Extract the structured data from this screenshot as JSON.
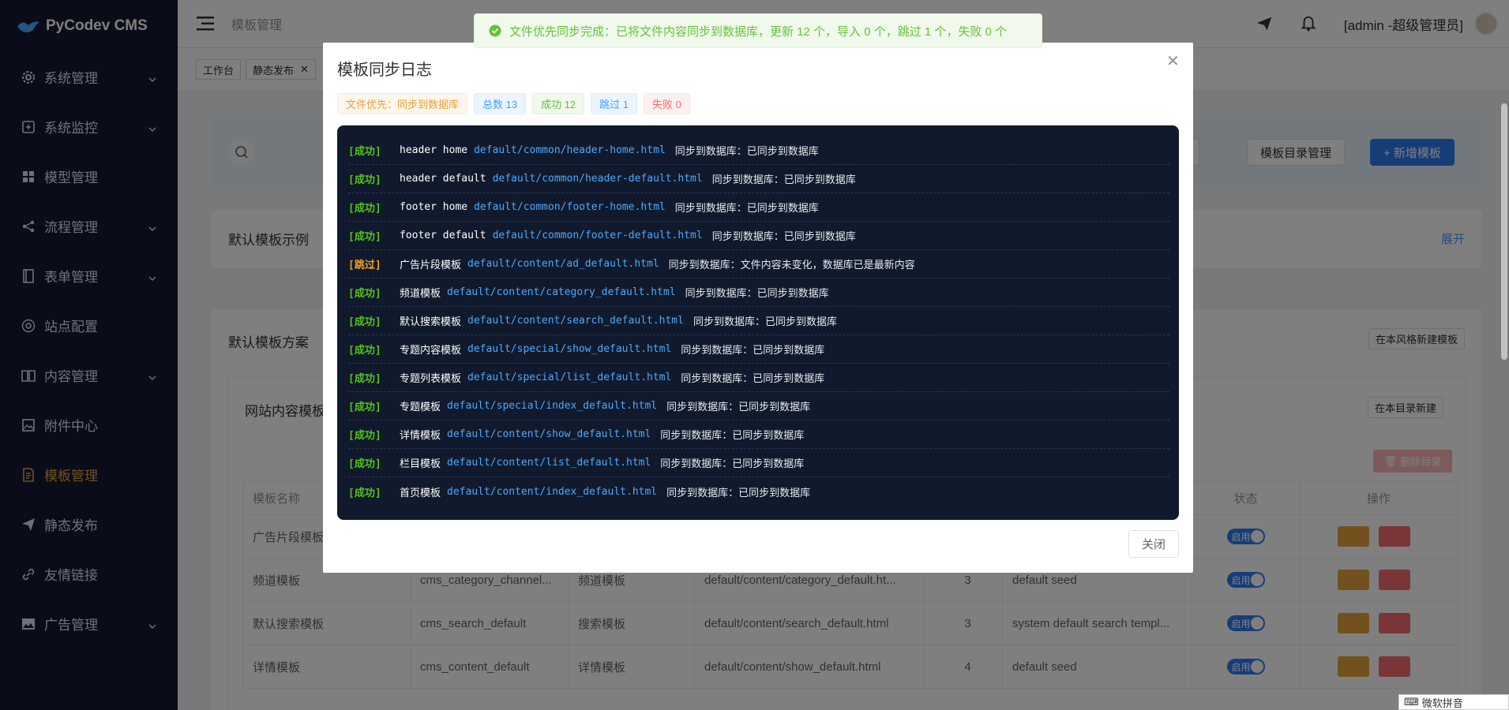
{
  "app": {
    "name": "PyCodev CMS"
  },
  "sidebar": {
    "items": [
      {
        "label": "系统管理",
        "icon": "gear-icon",
        "has_children": true
      },
      {
        "label": "系统监控",
        "icon": "monitor-icon",
        "has_children": true
      },
      {
        "label": "模型管理",
        "icon": "grid-icon",
        "has_children": false
      },
      {
        "label": "流程管理",
        "icon": "share-icon",
        "has_children": true
      },
      {
        "label": "表单管理",
        "icon": "form-icon",
        "has_children": true
      },
      {
        "label": "站点配置",
        "icon": "settings-icon",
        "has_children": false
      },
      {
        "label": "内容管理",
        "icon": "book-icon",
        "has_children": true
      },
      {
        "label": "附件中心",
        "icon": "image-icon",
        "has_children": false
      },
      {
        "label": "模板管理",
        "icon": "document-icon",
        "has_children": false,
        "active": true
      },
      {
        "label": "静态发布",
        "icon": "send-icon",
        "has_children": false
      },
      {
        "label": "友情链接",
        "icon": "link-icon",
        "has_children": false
      },
      {
        "label": "广告管理",
        "icon": "picture-icon",
        "has_children": true
      }
    ]
  },
  "header": {
    "breadcrumb": "模板管理",
    "user": "[admin -超级管理员]"
  },
  "tags": [
    {
      "label": "工作台",
      "closable": false
    },
    {
      "label": "静态发布",
      "closable": true
    }
  ],
  "background": {
    "buttons": {
      "manage_partial": "管理",
      "dir_manage": "模板目录管理",
      "add_template": "+ 新增模板"
    },
    "panel1": {
      "title": "默认模板示例",
      "link": "展开"
    },
    "panel2": {
      "title": "默认模板方案",
      "new_in_style": "在本风格新建模板"
    },
    "panel3": {
      "title": "网站内容模板",
      "new_in_dir": "在本目录新建",
      "delete_dir": "删除目录"
    },
    "table": {
      "headers": [
        "模板名称",
        "",
        "",
        "",
        "",
        "",
        "状态",
        "操作"
      ],
      "rows": [
        {
          "name": "广告片段模板",
          "code": "",
          "type": "",
          "path": "",
          "ver": "",
          "note": "",
          "status": "启用"
        },
        {
          "name": "频道模板",
          "code": "cms_category_channel...",
          "type": "频道模板",
          "path": "default/content/category_default.ht...",
          "ver": "3",
          "note": "default seed",
          "status": "启用"
        },
        {
          "name": "默认搜索模板",
          "code": "cms_search_default",
          "type": "搜索模板",
          "path": "default/content/search_default.html",
          "ver": "3",
          "note": "system default search templ...",
          "status": "启用"
        },
        {
          "name": "详情模板",
          "code": "cms_content_default",
          "type": "详情模板",
          "path": "default/content/show_default.html",
          "ver": "4",
          "note": "default seed",
          "status": "启用"
        }
      ]
    }
  },
  "toast": {
    "message": "文件优先同步完成：已将文件内容同步到数据库，更新 12 个，导入 0 个，跳过 1 个，失败 0 个",
    "type": "success"
  },
  "modal": {
    "title": "模板同步日志",
    "close_label": "关闭",
    "badges": [
      {
        "label": "文件优先：同步到数据库",
        "kind": "warn"
      },
      {
        "label": "总数 13",
        "kind": "info"
      },
      {
        "label": "成功 12",
        "kind": "succ"
      },
      {
        "label": "跳过 1",
        "kind": "info"
      },
      {
        "label": "失败 0",
        "kind": "err"
      }
    ],
    "logs": [
      {
        "level": "[成功]",
        "status": "ok",
        "name": "header home",
        "path": "default/common/header-home.html",
        "msg": "同步到数据库：已同步到数据库"
      },
      {
        "level": "[成功]",
        "status": "ok",
        "name": "header default",
        "path": "default/common/header-default.html",
        "msg": "同步到数据库：已同步到数据库"
      },
      {
        "level": "[成功]",
        "status": "ok",
        "name": "footer home",
        "path": "default/common/footer-home.html",
        "msg": "同步到数据库：已同步到数据库"
      },
      {
        "level": "[成功]",
        "status": "ok",
        "name": "footer default",
        "path": "default/common/footer-default.html",
        "msg": "同步到数据库：已同步到数据库"
      },
      {
        "level": "[跳过]",
        "status": "skip",
        "name": "广告片段模板",
        "path": "default/content/ad_default.html",
        "msg": "同步到数据库：文件内容未变化，数据库已是最新内容"
      },
      {
        "level": "[成功]",
        "status": "ok",
        "name": "频道模板",
        "path": "default/content/category_default.html",
        "msg": "同步到数据库：已同步到数据库"
      },
      {
        "level": "[成功]",
        "status": "ok",
        "name": "默认搜索模板",
        "path": "default/content/search_default.html",
        "msg": "同步到数据库：已同步到数据库"
      },
      {
        "level": "[成功]",
        "status": "ok",
        "name": "专题内容模板",
        "path": "default/special/show_default.html",
        "msg": "同步到数据库：已同步到数据库"
      },
      {
        "level": "[成功]",
        "status": "ok",
        "name": "专题列表模板",
        "path": "default/special/list_default.html",
        "msg": "同步到数据库：已同步到数据库"
      },
      {
        "level": "[成功]",
        "status": "ok",
        "name": "专题模板",
        "path": "default/special/index_default.html",
        "msg": "同步到数据库：已同步到数据库"
      },
      {
        "level": "[成功]",
        "status": "ok",
        "name": "详情模板",
        "path": "default/content/show_default.html",
        "msg": "同步到数据库：已同步到数据库"
      },
      {
        "level": "[成功]",
        "status": "ok",
        "name": "栏目模板",
        "path": "default/content/list_default.html",
        "msg": "同步到数据库：已同步到数据库"
      },
      {
        "level": "[成功]",
        "status": "ok",
        "name": "首页模板",
        "path": "default/content/index_default.html",
        "msg": "同步到数据库：已同步到数据库"
      }
    ]
  },
  "ime": {
    "label": "微软拼音"
  },
  "colors": {
    "sidebar_bg": "#141a33",
    "active_menu": "#e6a23c",
    "primary": "#2f7bf0",
    "log_bg": "#101a2c",
    "success": "#67c23a"
  }
}
